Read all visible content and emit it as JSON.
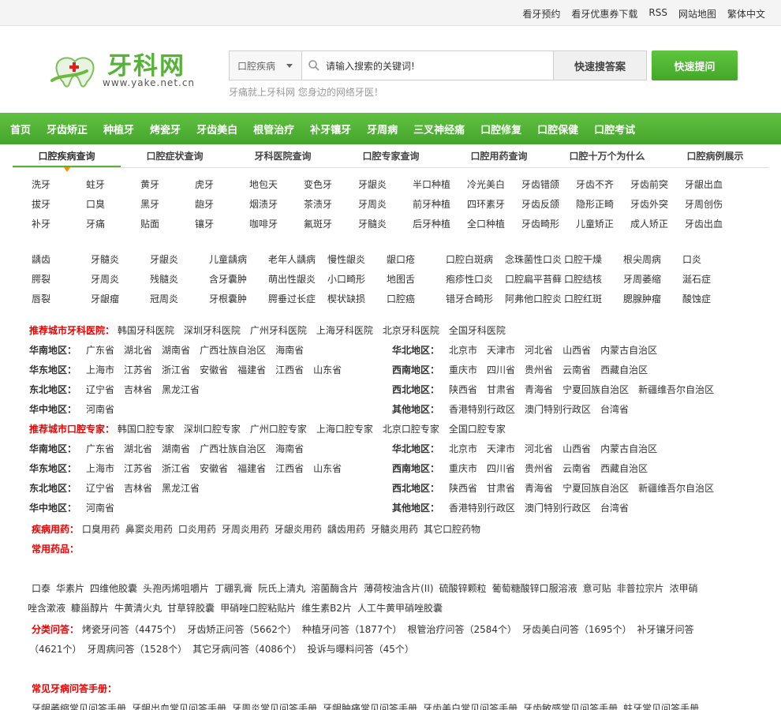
{
  "top_links": [
    "看牙预约",
    "看牙优惠券下载",
    "RSS",
    "网站地图",
    "繁体中文"
  ],
  "logo": {
    "text": "牙科网",
    "url": "www.yake.net.cn"
  },
  "search": {
    "category": "口腔疾病",
    "placeholder": "请输入搜索的关键词!",
    "button": "快速搜答案"
  },
  "ask_button": "快速提问",
  "slogan": "牙痛就上牙科网 您身边的网络牙医！",
  "nav": [
    "首页",
    "牙齿矫正",
    "种植牙",
    "烤瓷牙",
    "牙齿美白",
    "根管治疗",
    "补牙镶牙",
    "牙周病",
    "三叉神经痛",
    "口腔修复",
    "口腔保健",
    "口腔考试"
  ],
  "subtabs": [
    "口腔疾病查询",
    "口腔症状查询",
    "牙科医院查询",
    "口腔专家查询",
    "口腔用药查询",
    "口腔十万个为什么",
    "口腔病例展示"
  ],
  "disease_grid_1": [
    "洗牙",
    "蛀牙",
    "黄牙",
    "虎牙",
    "地包天",
    "变色牙",
    "牙龈炎",
    "半口种植",
    "冷光美白",
    "牙齿错颌",
    "牙齿不齐",
    "牙齿前突",
    "牙龈出血",
    "拔牙",
    "口臭",
    "黑牙",
    "龅牙",
    "烟渍牙",
    "茶渍牙",
    "牙周炎",
    "前牙种植",
    "四环素牙",
    "牙齿反颌",
    "隐形正畸",
    "牙齿外突",
    "牙周创伤",
    "补牙",
    "牙痛",
    "贴面",
    "镶牙",
    "咖啡牙",
    "氟斑牙",
    "牙髓炎",
    "后牙种植",
    "全口种植",
    "牙齿畸形",
    "儿童矫正",
    "成人矫正",
    "牙齿出血"
  ],
  "disease_grid_2": [
    "龋齿",
    "牙髓炎",
    "牙龈炎",
    "儿童龋病",
    "老年人龋病",
    "慢性龈炎",
    "龈口疮",
    "口腔白斑病",
    "念珠菌性口炎",
    "口腔干燥",
    "根尖周病",
    "口炎",
    "腭裂",
    "牙周炎",
    "残髓炎",
    "含牙囊肿",
    "萌出性龈炎",
    "小口畸形",
    "地图舌",
    "疱疹性口炎",
    "口腔扁平苔藓",
    "口腔结核",
    "牙周萎缩",
    "涎石症",
    "唇裂",
    "牙龈瘤",
    "冠周炎",
    "牙根囊肿",
    "腭垂过长症",
    "楔状缺损",
    "口腔癌",
    "错牙合畸形",
    "阿弗他口腔炎",
    "口腔红斑",
    "腮腺肿瘤",
    "酸蚀症"
  ],
  "hospitals": {
    "title": "推荐城市牙科医院：",
    "cities": [
      "韩国牙科医院",
      "深圳牙科医院",
      "广州牙科医院",
      "上海牙科医院",
      "北京牙科医院",
      "全国牙科医院"
    ],
    "regions_left": [
      {
        "label": "华南地区：",
        "items": [
          "广东省",
          "湖北省",
          "湖南省",
          "广西壮族自治区",
          "海南省"
        ]
      },
      {
        "label": "华东地区：",
        "items": [
          "上海市",
          "江苏省",
          "浙江省",
          "安徽省",
          "福建省",
          "江西省",
          "山东省"
        ]
      },
      {
        "label": "东北地区：",
        "items": [
          "辽宁省",
          "吉林省",
          "黑龙江省"
        ]
      },
      {
        "label": "华中地区：",
        "items": [
          "河南省"
        ]
      }
    ],
    "regions_right": [
      {
        "label": "华北地区：",
        "items": [
          "北京市",
          "天津市",
          "河北省",
          "山西省",
          "内蒙古自治区"
        ]
      },
      {
        "label": "西南地区：",
        "items": [
          "重庆市",
          "四川省",
          "贵州省",
          "云南省",
          "西藏自治区"
        ]
      },
      {
        "label": "西北地区：",
        "items": [
          "陕西省",
          "甘肃省",
          "青海省",
          "宁夏回族自治区",
          "新疆维吾尔自治区"
        ]
      },
      {
        "label": "其他地区：",
        "items": [
          "香港特别行政区",
          "澳门特别行政区",
          "台湾省"
        ]
      }
    ]
  },
  "experts": {
    "title": "推荐城市口腔专家：",
    "cities": [
      "韩国口腔专家",
      "深圳口腔专家",
      "广州口腔专家",
      "上海口腔专家",
      "北京口腔专家",
      "全国口腔专家"
    ],
    "regions_left": [
      {
        "label": "华南地区：",
        "items": [
          "广东省",
          "湖北省",
          "湖南省",
          "广西壮族自治区",
          "海南省"
        ]
      },
      {
        "label": "华东地区：",
        "items": [
          "上海市",
          "江苏省",
          "浙江省",
          "安徽省",
          "福建省",
          "江西省",
          "山东省"
        ]
      },
      {
        "label": "东北地区：",
        "items": [
          "辽宁省",
          "吉林省",
          "黑龙江省"
        ]
      },
      {
        "label": "华中地区：",
        "items": [
          "河南省"
        ]
      }
    ],
    "regions_right": [
      {
        "label": "华北地区：",
        "items": [
          "北京市",
          "天津市",
          "河北省",
          "山西省",
          "内蒙古自治区"
        ]
      },
      {
        "label": "西南地区：",
        "items": [
          "重庆市",
          "四川省",
          "贵州省",
          "云南省",
          "西藏自治区"
        ]
      },
      {
        "label": "西北地区：",
        "items": [
          "陕西省",
          "甘肃省",
          "青海省",
          "宁夏回族自治区",
          "新疆维吾尔自治区"
        ]
      },
      {
        "label": "其他地区：",
        "items": [
          "香港特别行政区",
          "澳门特别行政区",
          "台湾省"
        ]
      }
    ]
  },
  "drugs": {
    "title": "疾病用药：",
    "items": [
      "口臭用药",
      "鼻窦炎用药",
      "口炎用药",
      "牙周炎用药",
      "牙龈炎用药",
      "龋齿用药",
      "牙髓炎用药",
      "其它口腔药物"
    ]
  },
  "common_drugs": {
    "title": "常用药品：",
    "line1": [
      "口泰",
      "华素片",
      "四维他胶囊",
      "头孢丙烯咀嚼片",
      "丁硼乳膏",
      "阮氏上清丸",
      "溶菌酶含片",
      "薄荷桉油含片(II)",
      "硫酸锌颗粒",
      "葡萄糖酸锌口服溶液",
      "意可贴",
      "非普拉宗片",
      "浓甲硝"
    ],
    "line2": [
      "唑含漱液",
      "糠甾醇片",
      "牛黄清火丸",
      "甘草锌胶囊",
      "甲硝唑口腔粘贴片",
      "维生素B2片",
      "人工牛黄甲硝唑胶囊"
    ]
  },
  "categories": {
    "title": "分类问答：",
    "line1": [
      "烤瓷牙问答（4475个）",
      "牙齿矫正问答（5662个）",
      "种植牙问答（1877个）",
      "根管治疗问答（2584个）",
      "牙齿美白问答（1695个）",
      "补牙镶牙问答"
    ],
    "line2": [
      "（4621个）",
      "牙周病问答（1528个）",
      "其它牙病问答（4086个）",
      "投诉与曝料问答（45个）"
    ]
  },
  "manual": {
    "title": "常见牙病问答手册：",
    "items": [
      "牙龈萎缩常见问答手册",
      "牙龈出血常见问答手册",
      "牙周炎常见问答手册",
      "牙龈肿痛常见问答手册",
      "牙齿美白常见问答手册",
      "牙齿敏感常见问答手册",
      "蛀牙常见问答手册"
    ]
  },
  "colors": {
    "brand_green": "#4aae2f",
    "accent_red": "#e00000",
    "accent_orange": "#ff8a00"
  }
}
